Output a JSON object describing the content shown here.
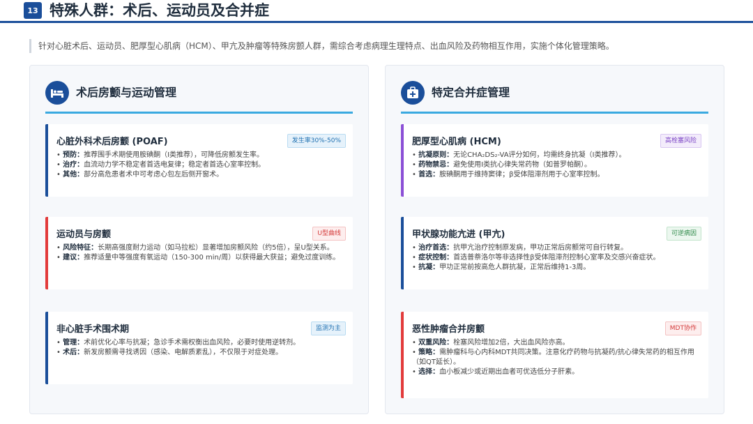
{
  "header": {
    "page_number": "13",
    "title": "特殊人群：术后、运动员及合并症"
  },
  "intro": "针对心脏术后、运动员、肥厚型心肌病（HCM）、甲亢及肿瘤等特殊房颤人群，需综合考虑病理生理特点、出血风险及药物相互作用，实施个体化管理策略。",
  "left_panel": {
    "icon": "surgery-bed-icon",
    "title": "术后房颤与运动管理",
    "cards": [
      {
        "title": "心脏外科术后房颤 (POAF)",
        "badge": "发生率30%-50%",
        "points": [
          {
            "label": "预防",
            "text": "推荐围手术期使用胺碘酮（I类推荐），可降低房颤发生率。"
          },
          {
            "label": "治疗",
            "text": "血流动力学不稳定者首选电复律；稳定者首选心室率控制。"
          },
          {
            "label": "其他",
            "text": "部分高危患者术中可考虑心包左后侧开窗术。"
          }
        ]
      },
      {
        "title": "运动员与房颤",
        "badge": "U型曲线",
        "points": [
          {
            "label": "风险特征",
            "text": "长期高强度耐力运动（如马拉松）显著增加房颤风险（约5倍），呈U型关系。"
          },
          {
            "label": "建议",
            "text": "推荐适量中等强度有氧运动（150-300 min/周）以获得最大获益；避免过度训练。"
          }
        ]
      },
      {
        "title": "非心脏手术围术期",
        "badge": "监测为主",
        "points": [
          {
            "label": "管理",
            "text": "术前优化心率与抗凝；急诊手术需权衡出血风险，必要时使用逆转剂。"
          },
          {
            "label": "术后",
            "text": "新发房颤需寻找诱因（感染、电解质紊乱），不仅限于对症处理。"
          }
        ]
      }
    ]
  },
  "right_panel": {
    "icon": "medical-kit-icon",
    "title": "特定合并症管理",
    "cards": [
      {
        "title": "肥厚型心肌病 (HCM)",
        "badge": "高栓塞风险",
        "points": [
          {
            "label": "抗凝原则",
            "text": "无论CHA₂DS₂-VA评分如何，均需终身抗凝（I类推荐）。"
          },
          {
            "label": "药物禁忌",
            "text": "避免使用I类抗心律失常药物（如普罗帕酮）。"
          },
          {
            "label": "首选",
            "text": "胺碘酮用于维持窦律；β受体阻滞剂用于心室率控制。"
          }
        ]
      },
      {
        "title": "甲状腺功能亢进 (甲亢)",
        "badge": "可逆病因",
        "points": [
          {
            "label": "治疗首选",
            "text": "抗甲亢治疗控制原发病，甲功正常后房颤常可自行转复。"
          },
          {
            "label": "症状控制",
            "text": "首选普萘洛尔等非选择性β受体阻滞剂控制心室率及交感兴奋症状。"
          },
          {
            "label": "抗凝",
            "text": "甲功正常前按高危人群抗凝，正常后维持1-3周。"
          }
        ]
      },
      {
        "title": "恶性肿瘤合并房颤",
        "badge": "MDT协作",
        "points": [
          {
            "label": "双重风险",
            "text": "栓塞风险增加2倍，大出血风险亦高。"
          },
          {
            "label": "策略",
            "text": "需肿瘤科与心内科MDT共同决策。注意化疗药物与抗凝药/抗心律失常药的相互作用（如QT延长）。"
          },
          {
            "label": "选择",
            "text": "血小板减少或近期出血者可优选低分子肝素。"
          }
        ]
      }
    ]
  },
  "colors": {
    "primary": "#1a4e9a",
    "accent_line": "#3aa9e0",
    "red": "#e23b3b",
    "purple": "#8b4fd6"
  }
}
